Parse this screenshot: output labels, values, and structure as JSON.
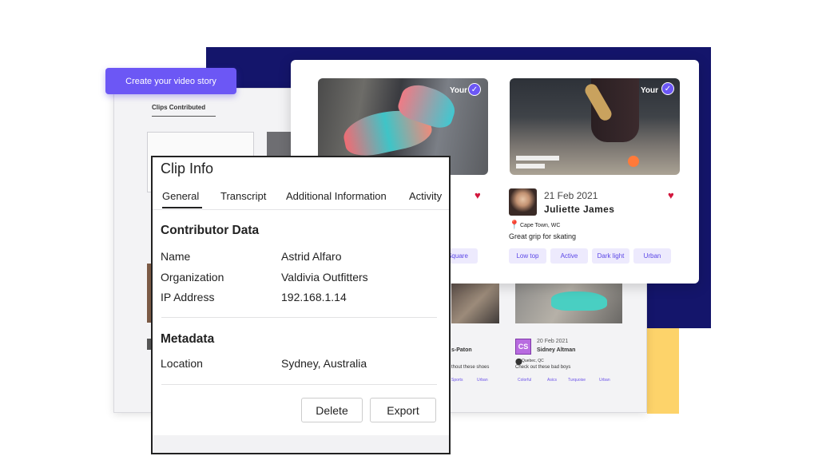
{
  "create_button": {
    "label": "Create your video story"
  },
  "back_screen": {
    "tab_label": "Clips Contributed",
    "cards": [
      {
        "name_fragment": "s-Paton",
        "caption_fragment": "thout these shoes",
        "tags": [
          "Sports",
          "Urban"
        ]
      },
      {
        "avatar_initials": "CS",
        "date": "20 Feb 2021",
        "name": "Sidney Altman",
        "location": "Quebec, QC",
        "caption": "Check out these bad boys",
        "tags": [
          "Colorful",
          "Asics",
          "Turquoise",
          "Urban"
        ]
      }
    ]
  },
  "front_cards": [
    {
      "brand": "Your",
      "visible_tag": "Square"
    },
    {
      "brand": "Your",
      "date": "21 Feb 2021",
      "name": "Juliette James",
      "location": "Cape Town, WC",
      "caption": "Great grip for skating",
      "tags": [
        "Low top",
        "Active",
        "Dark light",
        "Urban"
      ]
    }
  ],
  "dialog": {
    "title": "Clip Info",
    "tabs": [
      "General",
      "Transcript",
      "Additional Information",
      "Activity"
    ],
    "contributor": {
      "heading": "Contributor Data",
      "rows": [
        {
          "label": "Name",
          "value": "Astrid Alfaro"
        },
        {
          "label": "Organization",
          "value": "Valdivia Outfitters"
        },
        {
          "label": "IP Address",
          "value": "192.168.1.14"
        }
      ]
    },
    "metadata": {
      "heading": "Metadata",
      "rows": [
        {
          "label": "Location",
          "value": "Sydney, Australia"
        }
      ]
    },
    "buttons": {
      "delete": "Delete",
      "export": "Export"
    }
  },
  "icons": {
    "heart": "heart-icon",
    "pin": "map-pin-icon",
    "check": "check-badge-icon"
  },
  "colors": {
    "accent": "#6c57f5",
    "navy": "#14156b",
    "yellow": "#fdd36a",
    "heart": "#d2163c"
  }
}
